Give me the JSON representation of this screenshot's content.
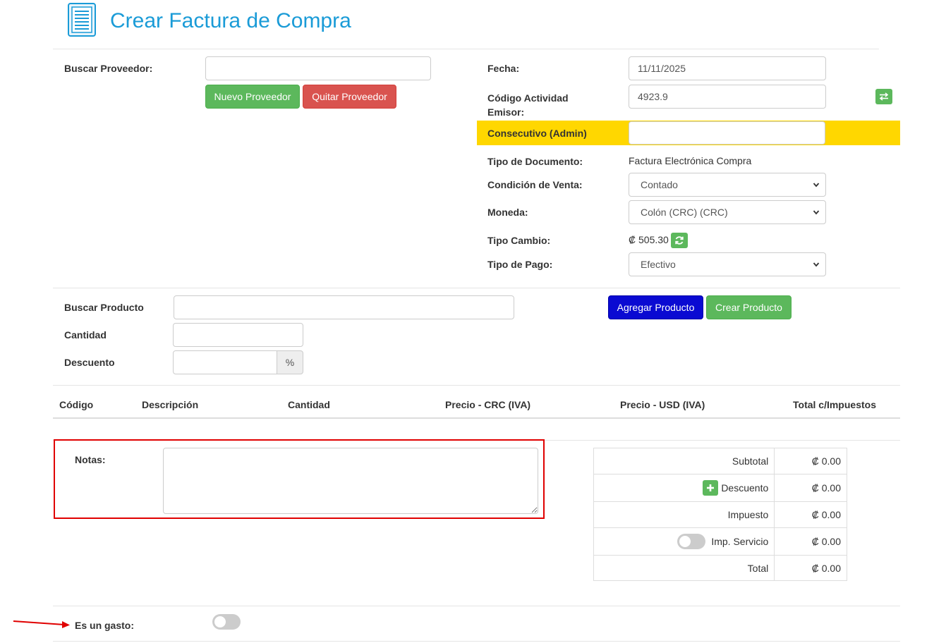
{
  "header": {
    "title": "Crear Factura de Compra",
    "icon": "document-list-icon",
    "accent": "#1a9bd7"
  },
  "supplier": {
    "search_label": "Buscar Proveedor:",
    "search_value": "",
    "new_button": "Nuevo Proveedor",
    "remove_button": "Quitar Proveedor"
  },
  "invoice": {
    "date_label": "Fecha:",
    "date_value": "11/11/2025",
    "activity_label_line1": "Código Actividad",
    "activity_label_line2": "Emisor:",
    "activity_value": "4923.9",
    "consecutive_label": "Consecutivo (Admin)",
    "consecutive_value": "",
    "consecutive_highlight": "#ffd700",
    "doc_type_label": "Tipo de Documento:",
    "doc_type_value": "Factura Electrónica Compra",
    "sale_condition_label": "Condición de Venta:",
    "sale_condition_value": "Contado",
    "currency_label": "Moneda:",
    "currency_value": "Colón (CRC) (CRC)",
    "exchange_label": "Tipo Cambio:",
    "exchange_value": "₡ 505.30",
    "payment_type_label": "Tipo de Pago:",
    "payment_type_value": "Efectivo"
  },
  "product": {
    "search_label": "Buscar Producto",
    "quantity_label": "Cantidad",
    "discount_label": "Descuento",
    "discount_addon": "%",
    "add_button": "Agregar Producto",
    "create_button": "Crear Producto"
  },
  "table": {
    "columns": [
      "Código",
      "Descripción",
      "Cantidad",
      "Precio - CRC (IVA)",
      "Precio - USD (IVA)",
      "Total c/Impuestos"
    ]
  },
  "notes": {
    "label": "Notas:",
    "value": "",
    "highlight_border": "#e00000"
  },
  "totals": {
    "subtotal_label": "Subtotal",
    "subtotal_value": "₡ 0.00",
    "discount_label": "Descuento",
    "discount_value": "₡ 0.00",
    "tax_label": "Impuesto",
    "tax_value": "₡ 0.00",
    "service_label": "Imp. Servicio",
    "service_value": "₡ 0.00",
    "service_enabled": false,
    "total_label": "Total",
    "total_value": "₡ 0.00"
  },
  "expense": {
    "label": "Es un gasto:",
    "enabled": false
  }
}
